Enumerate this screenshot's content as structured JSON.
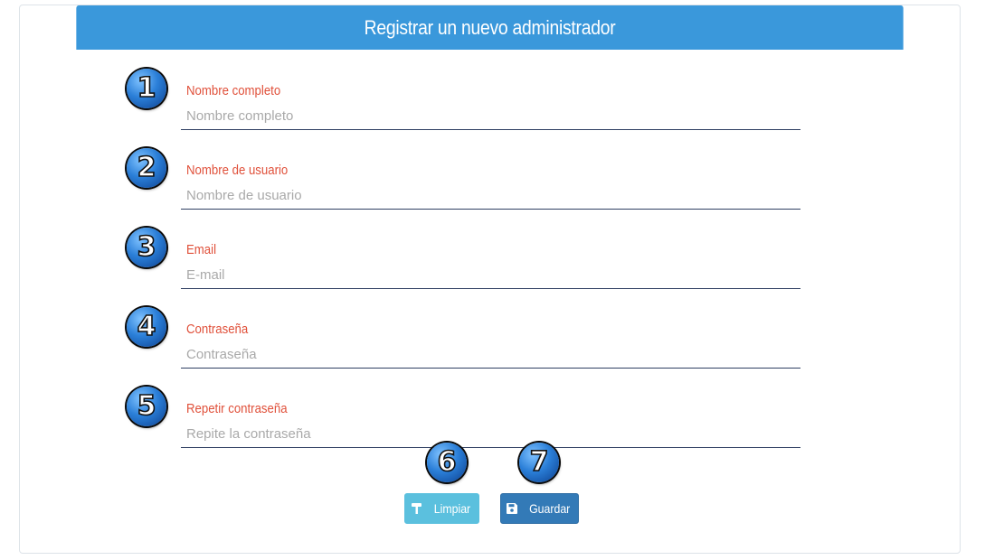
{
  "header": {
    "title": "Registrar un nuevo administrador"
  },
  "fields": [
    {
      "number": "1",
      "label": "Nombre completo",
      "placeholder": "Nombre completo",
      "value": ""
    },
    {
      "number": "2",
      "label": "Nombre de usuario",
      "placeholder": "Nombre de usuario",
      "value": ""
    },
    {
      "number": "3",
      "label": "Email",
      "placeholder": "E-mail",
      "value": ""
    },
    {
      "number": "4",
      "label": "Contraseña",
      "placeholder": "Contraseña",
      "value": ""
    },
    {
      "number": "5",
      "label": "Repetir contraseña",
      "placeholder": "Repite la contraseña",
      "value": ""
    }
  ],
  "buttons": {
    "clear": {
      "number": "6",
      "label": "Limpiar",
      "icon": "paint-roller-icon"
    },
    "save": {
      "number": "7",
      "label": "Guardar",
      "icon": "floppy-disk-icon"
    }
  },
  "colors": {
    "header": "#3a98db",
    "label": "#e0503a",
    "clear_button": "#5bc0de",
    "save_button": "#337ab7"
  }
}
